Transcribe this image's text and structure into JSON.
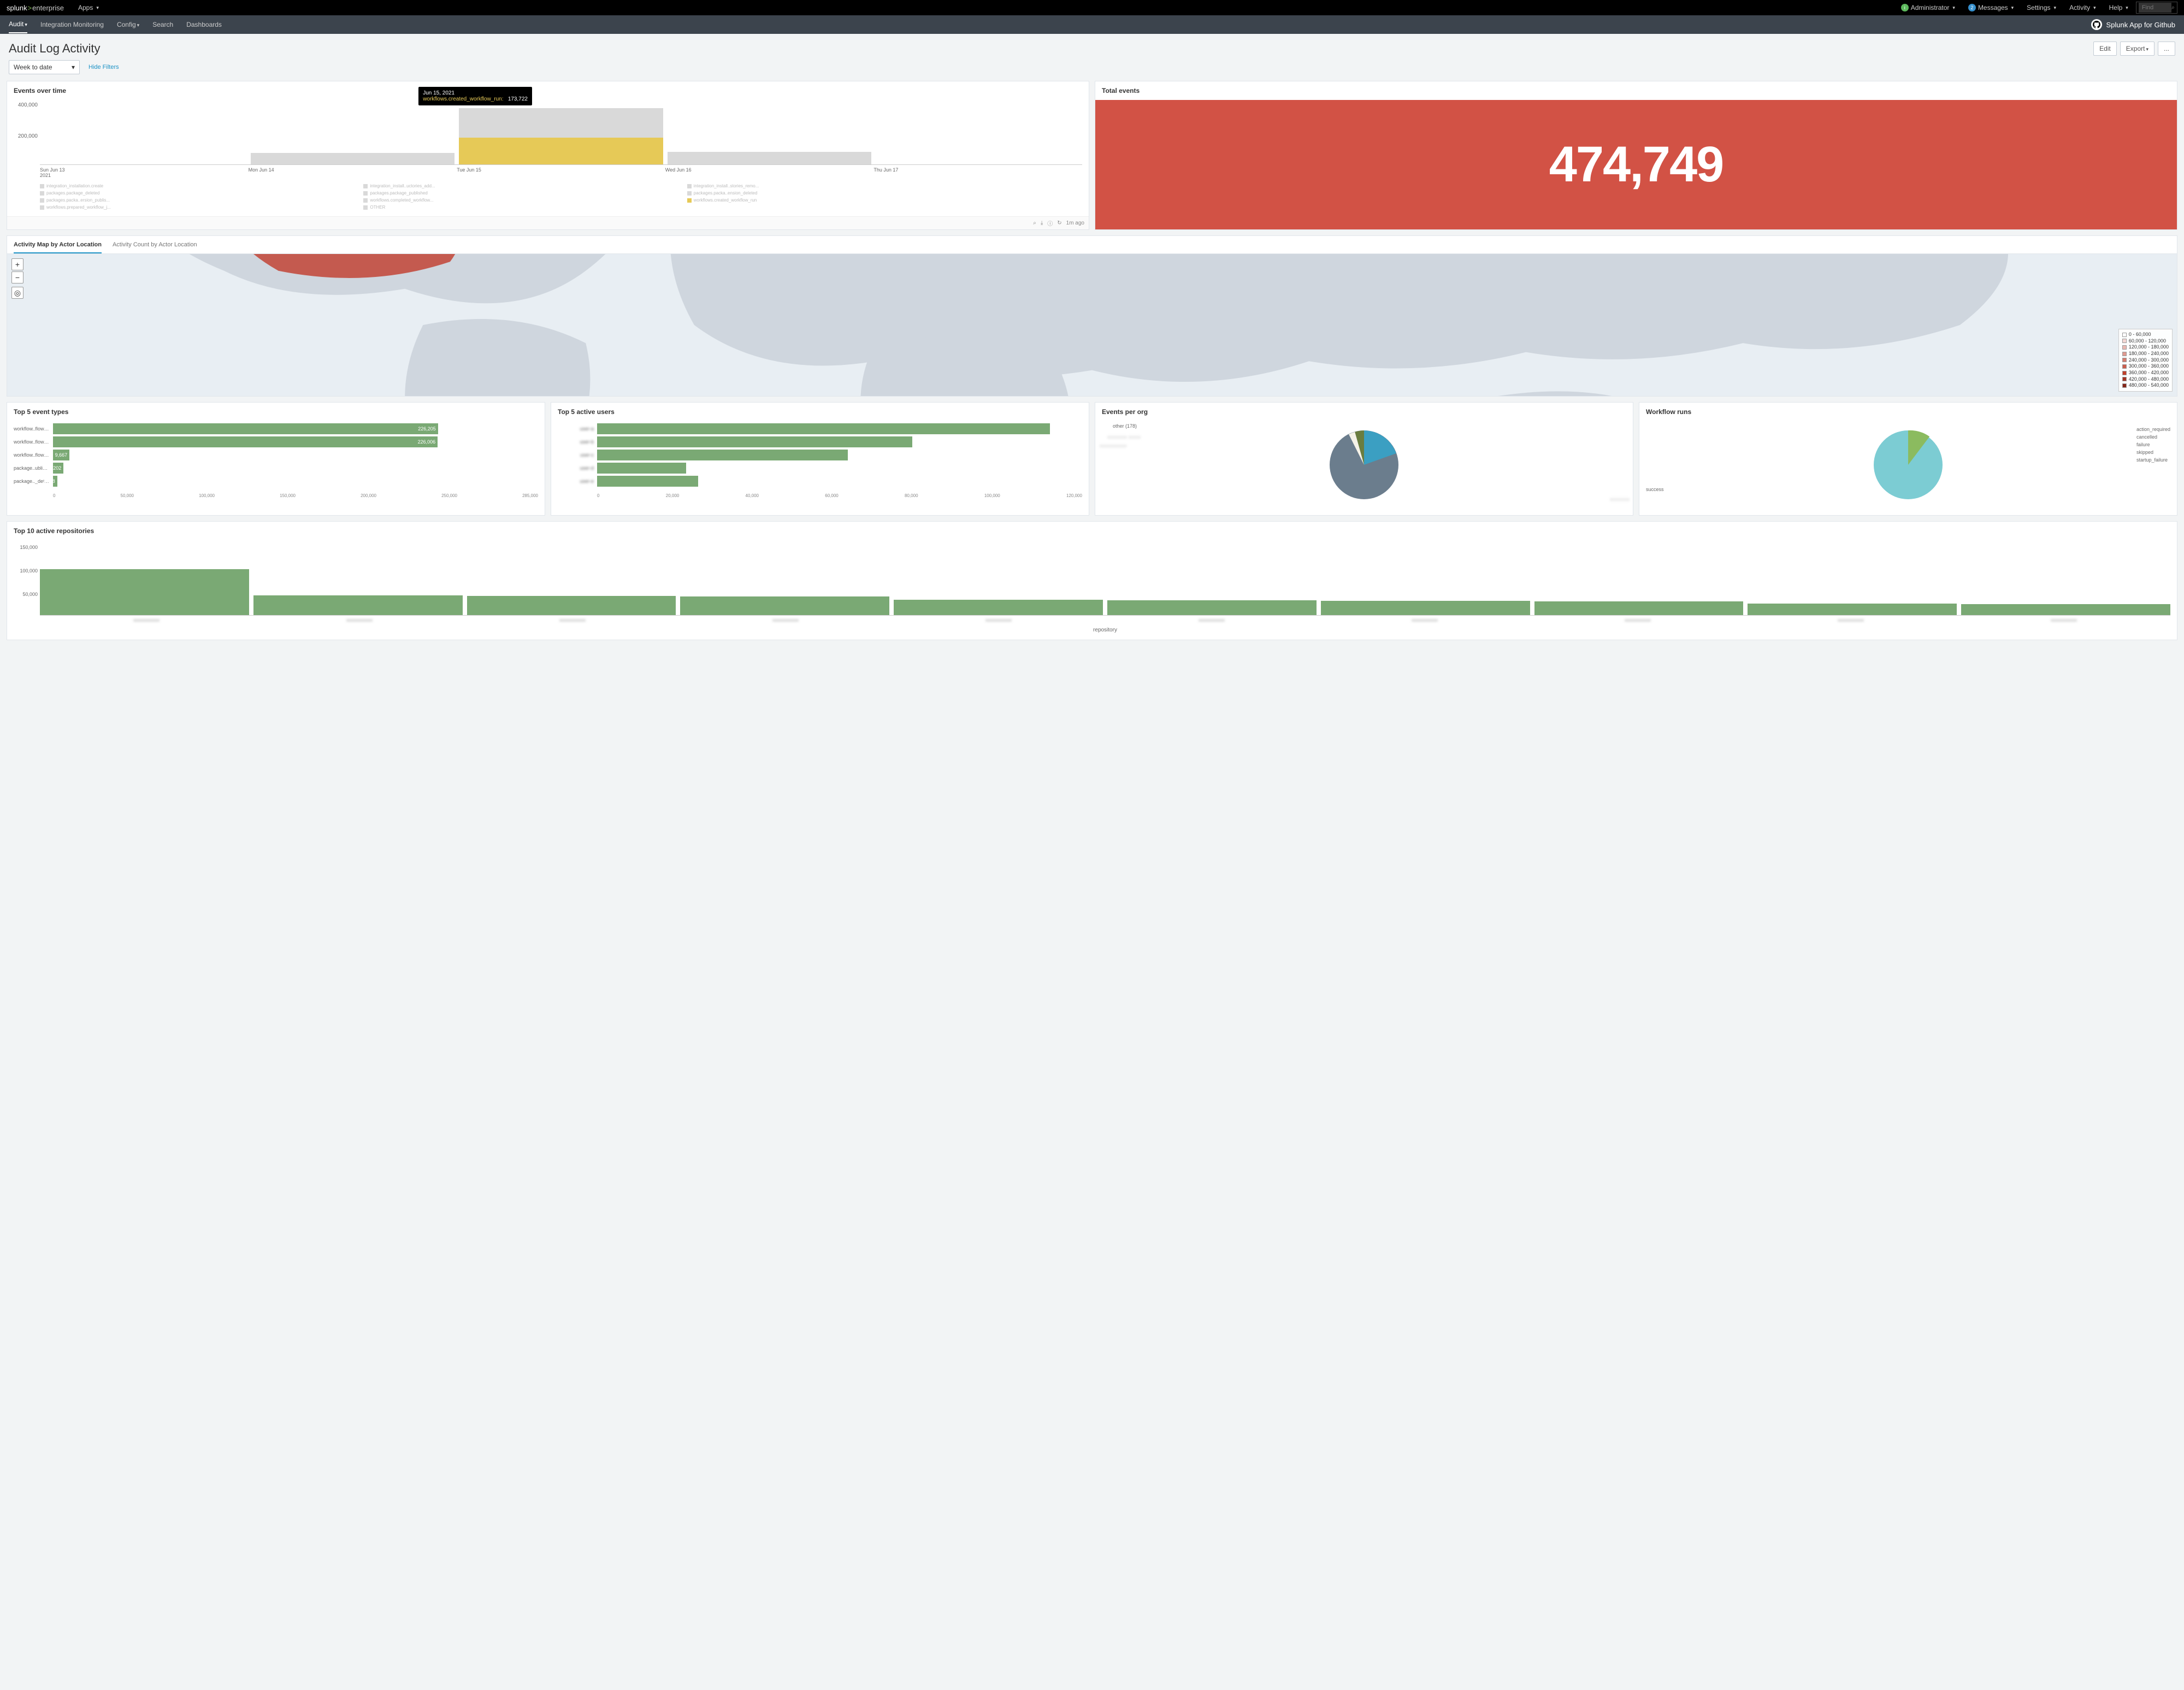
{
  "topbar": {
    "logo_splunk": "splunk",
    "logo_enterprise": "enterprise",
    "apps": "Apps",
    "admin": "Administrator",
    "messages": "Messages",
    "messages_count": "2",
    "settings": "Settings",
    "activity": "Activity",
    "help": "Help",
    "find_placeholder": "Find"
  },
  "navbar": {
    "items": [
      "Audit",
      "Integration Monitoring",
      "Config",
      "Search",
      "Dashboards"
    ],
    "app_name": "Splunk App for Github"
  },
  "page": {
    "title": "Audit Log Activity",
    "edit": "Edit",
    "export": "Export",
    "more": "..."
  },
  "filters": {
    "time": "Week to date",
    "hide": "Hide Filters"
  },
  "events_over_time": {
    "title": "Events over time",
    "y_ticks": [
      "400,000",
      "200,000",
      ""
    ],
    "x_ticks": [
      "Sun Jun 13\n2021",
      "Mon Jun 14",
      "Tue Jun 15",
      "Wed Jun 16",
      "Thu Jun 17"
    ],
    "tooltip_date": "Jun 15, 2021",
    "tooltip_label": "workflows.created_workflow_run:",
    "tooltip_value": "173,722",
    "legend": [
      {
        "label": "integration_installation.create",
        "color": "#d9d9d9"
      },
      {
        "label": "integration_install..uctories_add...",
        "color": "#d9d9d9"
      },
      {
        "label": "integration_install..stories_remo...",
        "color": "#d9d9d9"
      },
      {
        "label": "packages.package_deleted",
        "color": "#d9d9d9"
      },
      {
        "label": "packages.package_published",
        "color": "#d9d9d9"
      },
      {
        "label": "packages.packa..ension_deleted",
        "color": "#d9d9d9"
      },
      {
        "label": "packages.packa..ersion_publis...",
        "color": "#d9d9d9"
      },
      {
        "label": "workflows.completed_workflow...",
        "color": "#d9d9d9"
      },
      {
        "label": "workflows.created_workflow_run",
        "color": "#e6c957"
      },
      {
        "label": "workflows.prepared_workflow_j...",
        "color": "#d9d9d9"
      },
      {
        "label": "OTHER",
        "color": "#d9d9d9"
      }
    ],
    "footer_time": "1m ago"
  },
  "total_events": {
    "title": "Total events",
    "value": "474,749"
  },
  "map": {
    "tab_map": "Activity Map by Actor Location",
    "tab_count": "Activity Count by Actor Location",
    "legend": [
      {
        "label": "0 - 60,000",
        "color": "#ffffff"
      },
      {
        "label": "60,000 - 120,000",
        "color": "#f4d8d4"
      },
      {
        "label": "120,000 - 180,000",
        "color": "#eab9b2"
      },
      {
        "label": "180,000 - 240,000",
        "color": "#e09a90"
      },
      {
        "label": "240,000 - 300,000",
        "color": "#d67c6e"
      },
      {
        "label": "300,000 - 360,000",
        "color": "#cc5d4c"
      },
      {
        "label": "360,000 - 420,000",
        "color": "#c23f2a"
      },
      {
        "label": "420,000 - 480,000",
        "color": "#a43322"
      },
      {
        "label": "480,000 - 540,000",
        "color": "#86271a"
      }
    ]
  },
  "top5_event_types": {
    "title": "Top 5 event types",
    "max": 285000,
    "xticks": [
      "0",
      "50,000",
      "100,000",
      "150,000",
      "200,000",
      "250,000",
      "285,000"
    ],
    "rows": [
      {
        "label": "workflow..flow_run",
        "value": 226205,
        "display": "226,205"
      },
      {
        "label": "workflow..flow_run",
        "value": 226006,
        "display": "226,006"
      },
      {
        "label": "workflow..flow_job",
        "value": 9667,
        "display": "9,667"
      },
      {
        "label": "package..ublished",
        "value": 6202,
        "display": "6,202"
      },
      {
        "label": "package.._deleted",
        "value": 2468,
        "display": "2,468"
      }
    ]
  },
  "top5_active_users": {
    "title": "Top 5 active users",
    "max": 120000,
    "xticks": [
      "0",
      "20,000",
      "40,000",
      "60,000",
      "80,000",
      "100,000",
      "120,000"
    ],
    "rows": [
      {
        "label": "user-a",
        "value": 112000
      },
      {
        "label": "user-b",
        "value": 78000
      },
      {
        "label": "user-c",
        "value": 62000
      },
      {
        "label": "user-d",
        "value": 22000
      },
      {
        "label": "user-e",
        "value": 25000
      }
    ]
  },
  "events_per_org": {
    "title": "Events per org",
    "other_label": "other (178)"
  },
  "workflow_runs": {
    "title": "Workflow runs",
    "labels": [
      "action_required",
      "cancelled",
      "failure",
      "skipped",
      "startup_failure"
    ],
    "success": "success"
  },
  "top10_repos": {
    "title": "Top 10 active repositories",
    "y_ticks": [
      "150,000",
      "100,000",
      "50,000",
      ""
    ],
    "xlabel": "repository",
    "values": [
      98000,
      42000,
      41000,
      40000,
      32000,
      31000,
      30000,
      29000,
      24000,
      23000
    ],
    "max": 150000
  },
  "chart_data": [
    {
      "type": "bar",
      "title": "Events over time",
      "x": [
        "Sun Jun 13 2021",
        "Mon Jun 14",
        "Tue Jun 15",
        "Wed Jun 16",
        "Thu Jun 17"
      ],
      "series": [
        {
          "name": "workflows.created_workflow_run",
          "values": [
            null,
            null,
            173722,
            null,
            null
          ],
          "color": "#e6c957"
        },
        {
          "name": "other_stacked_total",
          "values": [
            0,
            70000,
            360000,
            80000,
            0
          ],
          "color": "#d9d9d9"
        }
      ],
      "ylim": [
        0,
        400000
      ],
      "ylabel": "",
      "xlabel": ""
    },
    {
      "type": "bar",
      "title": "Top 5 event types",
      "orientation": "horizontal",
      "categories": [
        "workflow..flow_run",
        "workflow..flow_run",
        "workflow..flow_job",
        "package..ublished",
        "package.._deleted"
      ],
      "values": [
        226205,
        226006,
        9667,
        6202,
        2468
      ],
      "xlim": [
        0,
        285000
      ]
    },
    {
      "type": "bar",
      "title": "Top 5 active users",
      "orientation": "horizontal",
      "categories": [
        "(blurred)",
        "(blurred)",
        "(blurred)",
        "(blurred)",
        "(blurred)"
      ],
      "values": [
        112000,
        78000,
        62000,
        22000,
        25000
      ],
      "xlim": [
        0,
        120000
      ]
    },
    {
      "type": "pie",
      "title": "Events per org",
      "slices": [
        {
          "name": "(org blurred)",
          "value": 70,
          "color": "#6b7d8d"
        },
        {
          "name": "(org blurred)",
          "value": 22,
          "color": "#3b9fc2"
        },
        {
          "name": "other (178)",
          "value": 6,
          "color": "#6a7d3f"
        },
        {
          "name": "(slice)",
          "value": 2,
          "color": "#f5f2e8"
        }
      ]
    },
    {
      "type": "pie",
      "title": "Workflow runs",
      "slices": [
        {
          "name": "success",
          "value": 88,
          "color": "#7cccd3"
        },
        {
          "name": "failure",
          "value": 8,
          "color": "#8bbb5f"
        },
        {
          "name": "action_required",
          "value": 1,
          "color": "#8bbb5f"
        },
        {
          "name": "cancelled",
          "value": 1,
          "color": "#8bbb5f"
        },
        {
          "name": "skipped",
          "value": 1,
          "color": "#8bbb5f"
        },
        {
          "name": "startup_failure",
          "value": 1,
          "color": "#8bbb5f"
        }
      ]
    },
    {
      "type": "bar",
      "title": "Top 10 active repositories",
      "categories": [
        "(blurred)",
        "(blurred)",
        "(blurred)",
        "(blurred)",
        "(blurred)",
        "(blurred)",
        "(blurred)",
        "(blurred)",
        "(blurred)",
        "(blurred)"
      ],
      "values": [
        98000,
        42000,
        41000,
        40000,
        32000,
        31000,
        30000,
        29000,
        24000,
        23000
      ],
      "ylim": [
        0,
        150000
      ],
      "xlabel": "repository"
    }
  ]
}
